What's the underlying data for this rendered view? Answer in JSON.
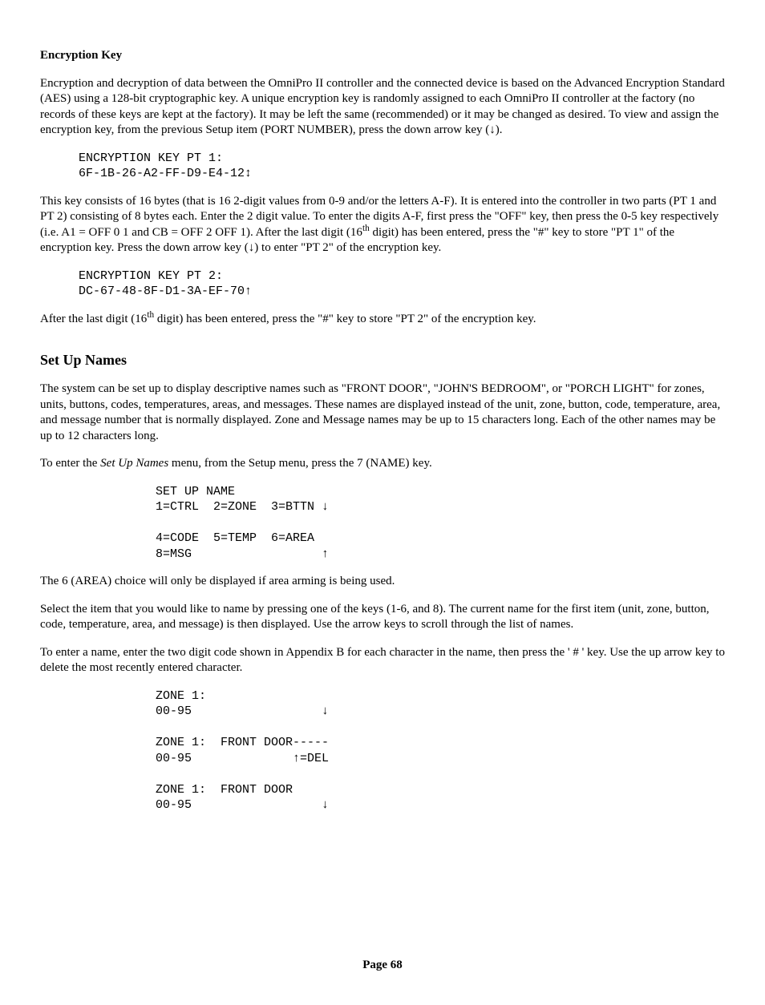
{
  "section1": {
    "title": "Encryption Key",
    "p1": "Encryption and decryption of data between the OmniPro II controller and the connected device is based on the Advanced Encryption Standard (AES) using a 128-bit cryptographic key.  A unique encryption key is randomly assigned to each OmniPro II controller at the factory (no records of these keys are kept at the factory).  It may be left the same (recommended) or it may be changed as desired.  To view and assign the encryption key, from the previous Setup item (PORT NUMBER), press the down arrow key (↓).",
    "code1_line1": "ENCRYPTION KEY PT 1:",
    "code1_line2": "6F-1B-26-A2-FF-D9-E4-12↕",
    "p2_part1": "This key consists of 16 bytes (that is 16 2-digit values from 0-9 and/or the letters A-F).  It is entered into the controller in two parts (PT 1 and PT 2) consisting of 8 bytes each.  Enter the 2 digit value.  To enter the digits A-F, first press the \"OFF\" key, then press the 0-5 key respectively (i.e. A1 = OFF 0 1 and CB = OFF 2 OFF 1).  After the last digit (16",
    "p2_sup": "th",
    "p2_part2": " digit) has been entered, press the \"#\" key to store \"PT 1\" of the encryption key.  Press the down arrow key (↓) to enter \"PT 2\" of the encryption key.",
    "code2_line1": "ENCRYPTION KEY PT 2:",
    "code2_line2": "DC-67-48-8F-D1-3A-EF-70↑",
    "p3_part1": "After the last digit (16",
    "p3_sup": "th",
    "p3_part2": " digit) has been entered, press the \"#\" key to store \"PT 2\" of the encryption key."
  },
  "section2": {
    "title": "Set Up Names",
    "p1": "The system can be set up to display descriptive names such as \"FRONT DOOR\", \"JOHN'S BEDROOM\", or \"PORCH LIGHT\" for zones, units, buttons, codes, temperatures, areas, and messages.  These names are displayed instead of the unit, zone, button, code, temperature, area, and message number that is normally displayed.  Zone and Message names may be up to 15 characters long.  Each of the other names may be up to 12 characters long.",
    "p2_part1": "To enter the ",
    "p2_italic": "Set Up Names",
    "p2_part2": " menu, from the Setup menu, press the 7 (NAME) key.",
    "code1_line1": "SET UP NAME",
    "code1_line2": "1=CTRL  2=ZONE  3=BTTN ↓",
    "code1_line3": "",
    "code1_line4": "4=CODE  5=TEMP  6=AREA",
    "code1_line5": "8=MSG                  ↑",
    "p3": "The 6 (AREA) choice will only be displayed if area arming is being used.",
    "p4": "Select the item that you would like to name by pressing one of the keys (1-6, and 8).  The current name for the first item (unit, zone, button, code, temperature, area, and message) is then displayed.  Use the arrow keys to scroll through the list of names.",
    "p5": "To enter a name, enter the two digit code shown in Appendix B for each character in the name, then press the ' # ' key.  Use the up arrow key to delete the most recently entered character.",
    "code2_line1": "ZONE 1:",
    "code2_line2": "00-95                  ↓",
    "code2_line3": "",
    "code2_line4": "ZONE 1:  FRONT DOOR-----",
    "code2_line5": "00-95              ↑=DEL",
    "code2_line6": "",
    "code2_line7": "ZONE 1:  FRONT DOOR",
    "code2_line8": "00-95                  ↓"
  },
  "footer": "Page 68"
}
